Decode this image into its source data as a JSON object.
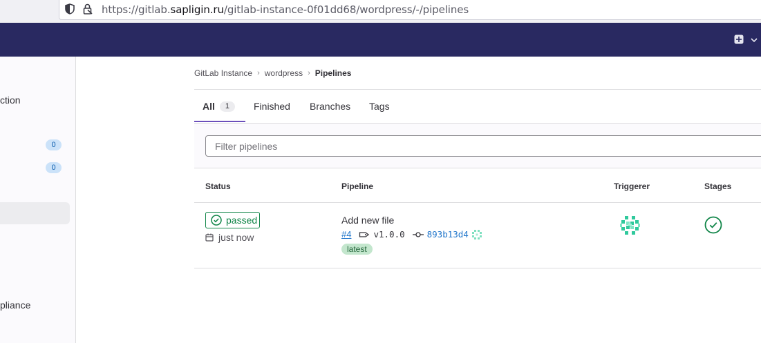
{
  "browser": {
    "url_prefix": "https://gitlab.",
    "url_domain": "sapligin.ru",
    "url_path": "/gitlab-instance-0f01dd68/wordpress/-/pipelines"
  },
  "sidebar": {
    "items": [
      {
        "label": "ction"
      },
      {
        "badge": "0"
      },
      {
        "badge": "0"
      },
      {
        "label": "pliance"
      }
    ]
  },
  "breadcrumb": {
    "items": [
      "GitLab Instance",
      "wordpress",
      "Pipelines"
    ]
  },
  "tabs": [
    {
      "label": "All",
      "count": "1"
    },
    {
      "label": "Finished"
    },
    {
      "label": "Branches"
    },
    {
      "label": "Tags"
    }
  ],
  "filter": {
    "placeholder": "Filter pipelines"
  },
  "table": {
    "headers": [
      "Status",
      "Pipeline",
      "Triggerer",
      "Stages"
    ],
    "rows": [
      {
        "status": "passed",
        "time": "just now",
        "title": "Add new file",
        "id": "#4",
        "tag": "v1.0.0",
        "sha": "893b13d4",
        "label": "latest"
      }
    ]
  },
  "colors": {
    "header": "#292961",
    "success": "#108548",
    "link": "#1f75cb",
    "tab_active": "#6b4fbb"
  }
}
